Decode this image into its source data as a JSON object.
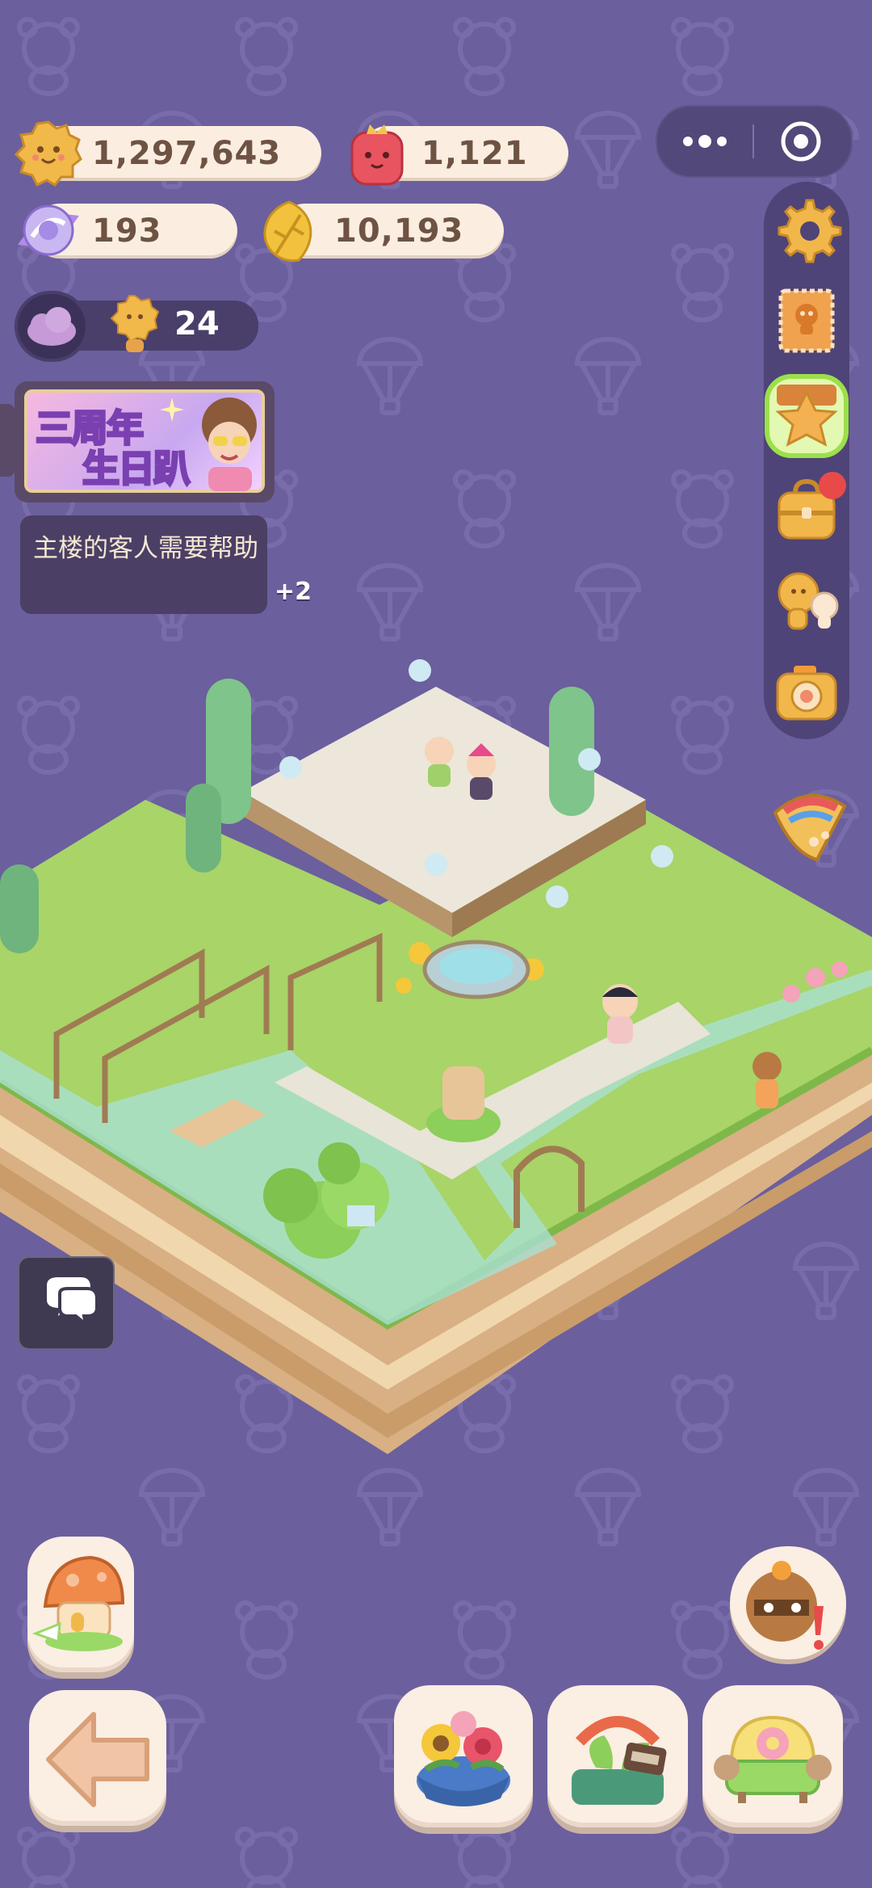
{
  "currencies": {
    "coins": "1,297,643",
    "candy": "1,121",
    "crystal": "193",
    "leaves": "10,193"
  },
  "status": {
    "visitors": "24"
  },
  "event_banner": {
    "title_line1": "三周年",
    "title_line2": "生日趴"
  },
  "quest": {
    "text": "主楼的客人需要帮助",
    "extra": "+2"
  },
  "colors": {
    "background": "#6b5f9d",
    "pill": "#fbeee1",
    "pill_text": "#6e5343",
    "side_panel": "#4f4477",
    "active_highlight": "#9be04a",
    "notification": "#e84a4a"
  },
  "icons": {
    "settings": "gear-icon",
    "cards": "stamp-card-icon",
    "star": "star-icon",
    "bag": "backpack-icon",
    "friends": "friends-icon",
    "camera": "camera-icon",
    "event": "croissant-icon",
    "chat": "chat-bubbles-icon",
    "back": "arrow-left-icon",
    "home": "mushroom-house-icon"
  }
}
